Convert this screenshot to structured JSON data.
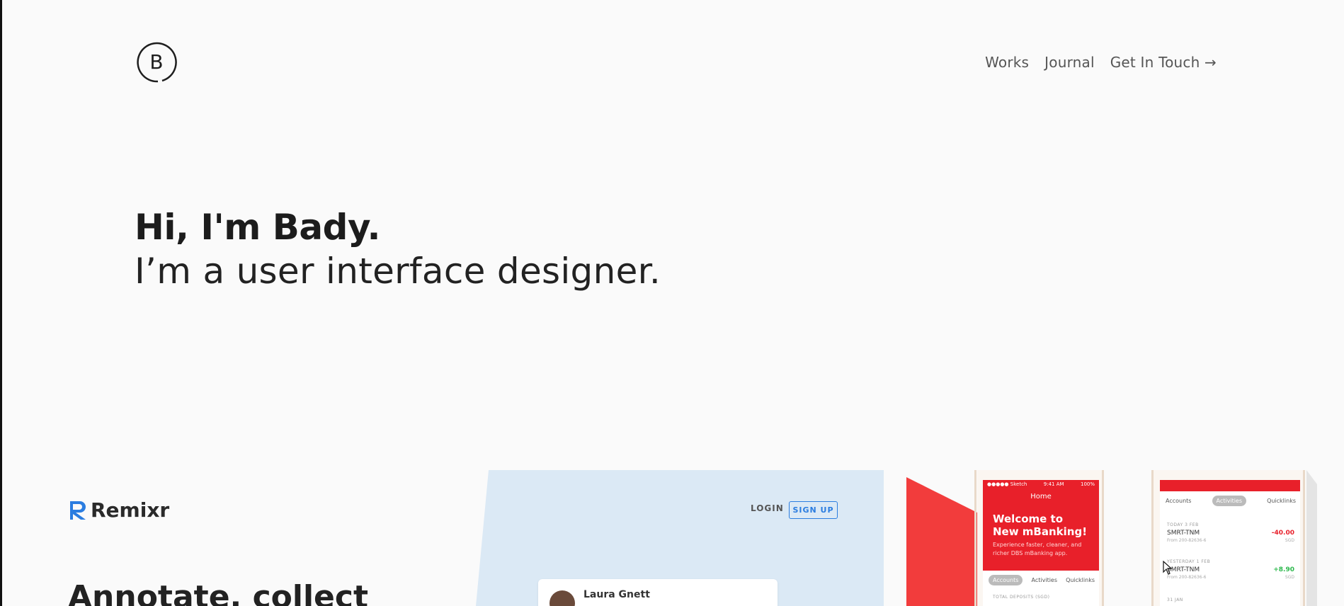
{
  "header": {
    "logo_letter": "B",
    "nav": [
      {
        "label": "Works"
      },
      {
        "label": "Journal"
      },
      {
        "label": "Get In Touch →"
      }
    ]
  },
  "hero": {
    "greeting": "Hi, I'm Bady.",
    "tagline": "I’m a user interface designer."
  },
  "project": {
    "brand": "Remixr",
    "headline": "Annotate, collect",
    "preview_login": "LOGIN",
    "preview_signup": "SIGN UP",
    "preview_user": "Laura Gnett"
  },
  "banking_preview": {
    "status_carrier": "●●●●● Sketch",
    "status_time": "9:41 AM",
    "status_battery": "100%",
    "screen_title": "Home",
    "welcome": "Welcome to New mBanking!",
    "sub": "Experience faster, cleaner, and richer DBS mBanking app.",
    "tabs": [
      "Accounts",
      "Activities",
      "Quicklinks"
    ],
    "deposits_label": "TOTAL DEPOSITS (SGD)",
    "transactions": [
      {
        "date": "TODAY 3 FEB",
        "name": "SMRT-TNM",
        "amount": "-40.00",
        "from": "From 200-82636-6",
        "currency": "SGD"
      },
      {
        "date": "YESTERDAY 1 FEB",
        "name": "SMRT-TNM",
        "amount": "+8.90",
        "from": "From 200-82636-6",
        "currency": "SGD"
      },
      {
        "date": "31 JAN",
        "name": "",
        "amount": "",
        "from": "",
        "currency": ""
      }
    ]
  },
  "colors": {
    "background": "#fafafa",
    "accent_red": "#e8202a",
    "remixr_blue": "#2b7de0",
    "remixr_panel": "#dbe9f5",
    "positive_green": "#2bb84b"
  }
}
